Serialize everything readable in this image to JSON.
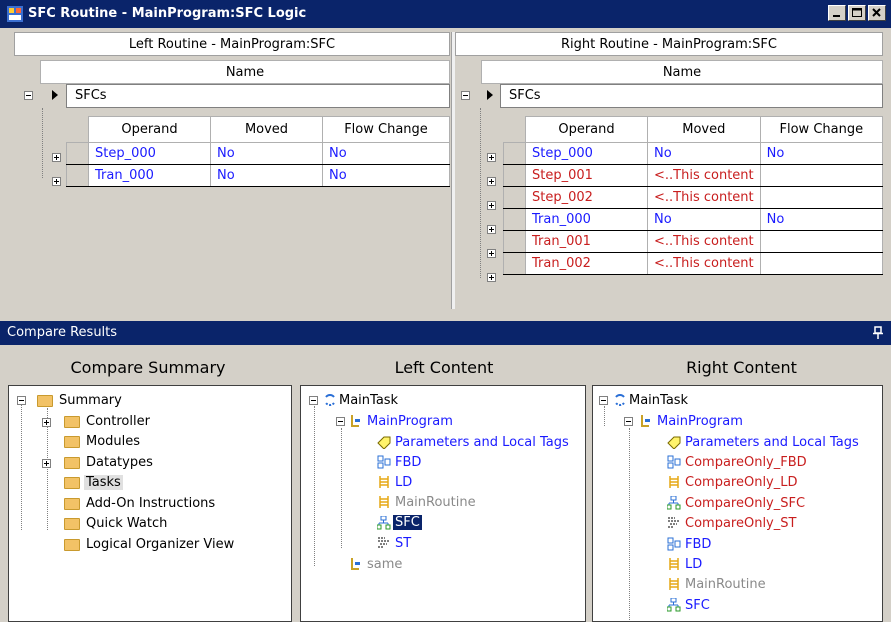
{
  "window": {
    "title": "SFC Routine - MainProgram:SFC  Logic"
  },
  "left_pane": {
    "header": "Left Routine - MainProgram:SFC",
    "name_header": "Name",
    "group_label": "SFCs",
    "columns": [
      "Operand",
      "Moved",
      "Flow Change"
    ],
    "rows": [
      {
        "operand": "Step_000",
        "moved": "No",
        "flow": "No",
        "color": "blue"
      },
      {
        "operand": "Tran_000",
        "moved": "No",
        "flow": "No",
        "color": "blue"
      }
    ]
  },
  "right_pane": {
    "header": "Right Routine - MainProgram:SFC",
    "name_header": "Name",
    "group_label": "SFCs",
    "columns": [
      "Operand",
      "Moved",
      "Flow Change"
    ],
    "rows": [
      {
        "operand": "Step_000",
        "moved": "No",
        "flow": "No",
        "color": "blue"
      },
      {
        "operand": "Step_001",
        "moved": "<..This content",
        "flow": "",
        "color": "red"
      },
      {
        "operand": "Step_002",
        "moved": "<..This content",
        "flow": "",
        "color": "red"
      },
      {
        "operand": "Tran_000",
        "moved": "No",
        "flow": "No",
        "color": "blue"
      },
      {
        "operand": "Tran_001",
        "moved": "<..This content",
        "flow": "",
        "color": "red"
      },
      {
        "operand": "Tran_002",
        "moved": "<..This content",
        "flow": "",
        "color": "red"
      }
    ]
  },
  "compare_results": {
    "title": "Compare Results",
    "pin": "↑",
    "summary_header": "Compare Summary",
    "left_header": "Left Content",
    "right_header": "Right Content",
    "summary_tree": {
      "root": "Summary",
      "items": [
        "Controller",
        "Modules",
        "Datatypes",
        "Tasks",
        "Add-On Instructions",
        "Quick Watch",
        "Logical Organizer View"
      ]
    },
    "left_tree": {
      "task": "MainTask",
      "program": "MainProgram",
      "items": [
        {
          "label": "Parameters and Local Tags",
          "color": "blue",
          "icon": "tag-icon"
        },
        {
          "label": "FBD",
          "color": "blue",
          "icon": "fbd-icon"
        },
        {
          "label": "LD",
          "color": "blue",
          "icon": "ladder-icon"
        },
        {
          "label": "MainRoutine",
          "color": "gray",
          "icon": "ladder-icon"
        },
        {
          "label": "SFC",
          "color": "selected",
          "icon": "sfc-icon"
        },
        {
          "label": "ST",
          "color": "blue",
          "icon": "st-icon"
        }
      ],
      "same": "same"
    },
    "right_tree": {
      "task": "MainTask",
      "program": "MainProgram",
      "items": [
        {
          "label": "Parameters and Local Tags",
          "color": "blue",
          "icon": "tag-icon"
        },
        {
          "label": "CompareOnly_FBD",
          "color": "red",
          "icon": "fbd-icon"
        },
        {
          "label": "CompareOnly_LD",
          "color": "red",
          "icon": "ladder-icon"
        },
        {
          "label": "CompareOnly_SFC",
          "color": "red",
          "icon": "sfc-icon"
        },
        {
          "label": "CompareOnly_ST",
          "color": "red",
          "icon": "st-icon"
        },
        {
          "label": "FBD",
          "color": "blue",
          "icon": "fbd-icon"
        },
        {
          "label": "LD",
          "color": "blue",
          "icon": "ladder-icon"
        },
        {
          "label": "MainRoutine",
          "color": "gray",
          "icon": "ladder-icon"
        },
        {
          "label": "SFC",
          "color": "blue",
          "icon": "sfc-icon"
        }
      ]
    }
  },
  "colors": {
    "titlebar": "#0a246a",
    "blue_text": "#1a1aff",
    "red_text": "#c81e1e",
    "gray_text": "#8a8a8a"
  }
}
